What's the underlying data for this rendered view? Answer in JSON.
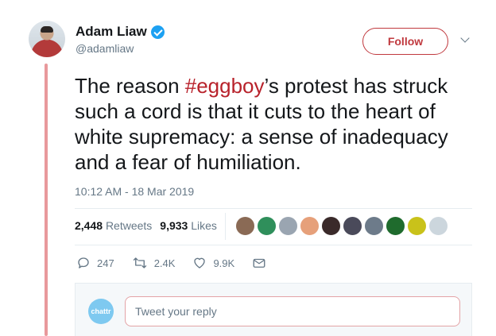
{
  "author": {
    "name": "Adam Liaw",
    "handle": "@adamliaw",
    "verified": true
  },
  "follow_button": {
    "label": "Follow"
  },
  "tweet": {
    "text_before": "The reason ",
    "hashtag": "#eggboy",
    "text_after": "’s protest has struck such a cord is that it cuts to the heart of white supremacy: a sense of inadequacy and a fear of humiliation.",
    "timestamp": "10:12 AM - 18 Mar 2019"
  },
  "stats": {
    "retweets_count": "2,448",
    "retweets_label": "Retweets",
    "likes_count": "9,933",
    "likes_label": "Likes",
    "liker_avatar_colors": [
      "#8a6a55",
      "#2f8f5b",
      "#9aa5b1",
      "#e6a07a",
      "#3a2a2a",
      "#4a4a5a",
      "#6d7b8a",
      "#1f6b2d",
      "#c9c21a",
      "#ccd6dd"
    ]
  },
  "actions": {
    "replies": "247",
    "retweets": "2.4K",
    "likes": "9.9K"
  },
  "reply": {
    "avatar_text": "chattr",
    "placeholder": "Tweet your reply"
  },
  "colors": {
    "accent": "#c0393e",
    "hashtag": "#b8222b",
    "thread_line": "#e8999c",
    "muted": "#657786"
  }
}
